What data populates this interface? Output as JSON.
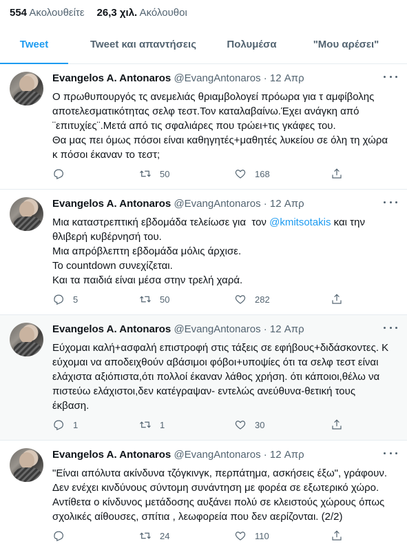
{
  "stats": {
    "following_count": "554",
    "following_label": "Ακολουθείτε",
    "followers_count": "26,3 χιλ.",
    "followers_label": "Ακόλουθοι"
  },
  "tabs": [
    {
      "label": "Tweet"
    },
    {
      "label": "Tweet και απαντήσεις"
    },
    {
      "label": "Πολυμέσα"
    },
    {
      "label": "\"Μου αρέσει\""
    }
  ],
  "tweets": [
    {
      "name": "Evangelos A. Antonaros",
      "handle": "@EvangAntonaros",
      "sep": "·",
      "date": "12 Απρ",
      "lines": [
        "Ο πρωθυπουργός τς ανεμελιάς θριαμβολογεί πρόωρα για τ αμφίβολης",
        "αποτελεσματικότητας σελφ τεστ.Τον καταλαβαίνω.Έχει ανάγκη από",
        "¨επιτυχίες¨.Μετά από τις σφαλιάρες που τρώει+τις γκάφες του.",
        "Θα μας πει όμως πόσοι είναι καθηγητές+μαθητές λυκείου σε όλη τη χώρα",
        "κ πόσοι έκαναν το τεστ;"
      ],
      "replies": "",
      "retweets": "50",
      "likes": "168"
    },
    {
      "name": "Evangelos A. Antonaros",
      "handle": "@EvangAntonaros",
      "sep": "·",
      "date": "12 Απρ",
      "line1_pre": "Μια καταστρεπτική εβδομάδα τελείωσε για  τον ",
      "line1_mention": "@kmitsotakis",
      "line1_post": " και την",
      "lines": [
        "θλιβερή κυβέρνησή του.",
        "Μια απρόβλεπτη εβδομάδα μόλις άρχισε.",
        "Το countdown συνεχίζεται.",
        "Και τα παιδιά είναι μέσα στην τρελή χαρά."
      ],
      "replies": "5",
      "retweets": "50",
      "likes": "282"
    },
    {
      "name": "Evangelos A. Antonaros",
      "handle": "@EvangAntonaros",
      "sep": "·",
      "date": "12 Απρ",
      "lines": [
        "Εύχομαι καλή+ασφαλή επιστροφή στις τάξεις σε εφήβους+διδάσκοντες. Κ",
        "εύχομαι να αποδειχθούν αβάσιμοι φόβοι+υποψίες ότι τα σελφ τεστ είναι",
        "ελάχιστα αξιόπιστα,ότι πολλοί έκαναν λάθος χρήση. ότι κάποιοι,θέλω να",
        "πιστεύω ελάχιστοι,δεν κατέγραψαν- εντελώς ανεύθυνα-θετική τους",
        "έκβαση."
      ],
      "replies": "1",
      "retweets": "1",
      "likes": "30"
    },
    {
      "name": "Evangelos A. Antonaros",
      "handle": "@EvangAntonaros",
      "sep": "·",
      "date": "12 Απρ",
      "lines": [
        "\"Είναι απόλυτα ακίνδυνα τζόγκινγκ, περπάτημα, ασκήσεις έξω\", γράφουν.",
        "Δεν ενέχει κινδύνους σύντομη συνάντηση με φορέα σε εξωτερικό χώρο.",
        "Αντίθετα ο κίνδυνος μετάδοσης αυξάνει πολύ σε κλειστούς χώρους όπως",
        "σχολικές αίθουσες, σπίτια , λεωφορεία που δεν αερίζονται. (2/2)"
      ],
      "replies": "",
      "retweets": "24",
      "likes": "110"
    }
  ]
}
